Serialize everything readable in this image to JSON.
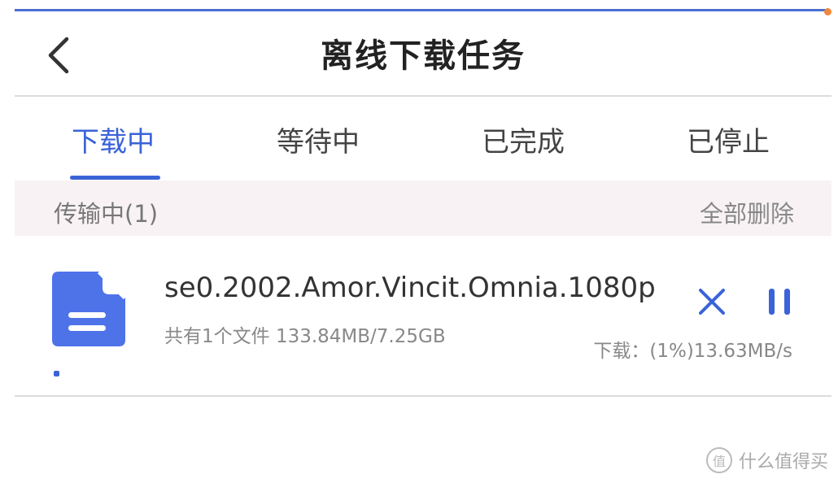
{
  "header": {
    "title": "离线下载任务"
  },
  "tabs": [
    {
      "label": "下载中",
      "active": true
    },
    {
      "label": "等待中",
      "active": false
    },
    {
      "label": "已完成",
      "active": false
    },
    {
      "label": "已停止",
      "active": false
    }
  ],
  "section": {
    "title": "传输中(1)",
    "delete_all_label": "全部删除"
  },
  "task": {
    "name": "se0.2002.Amor.Vincit.Omnia.1080p",
    "info": "共有1个文件 133.84MB/7.25GB",
    "speed": "下载：(1%)13.63MB/s",
    "progress_percent": 1
  },
  "colors": {
    "accent": "#3a63d8",
    "file_icon": "#4e73e8",
    "section_bg": "#f8f2f5"
  },
  "icons": {
    "back": "chevron-left-icon",
    "file": "file-document-icon",
    "cancel": "close-icon",
    "pause": "pause-icon"
  },
  "watermark": {
    "text": "什么值得买",
    "logo_char": "值"
  }
}
